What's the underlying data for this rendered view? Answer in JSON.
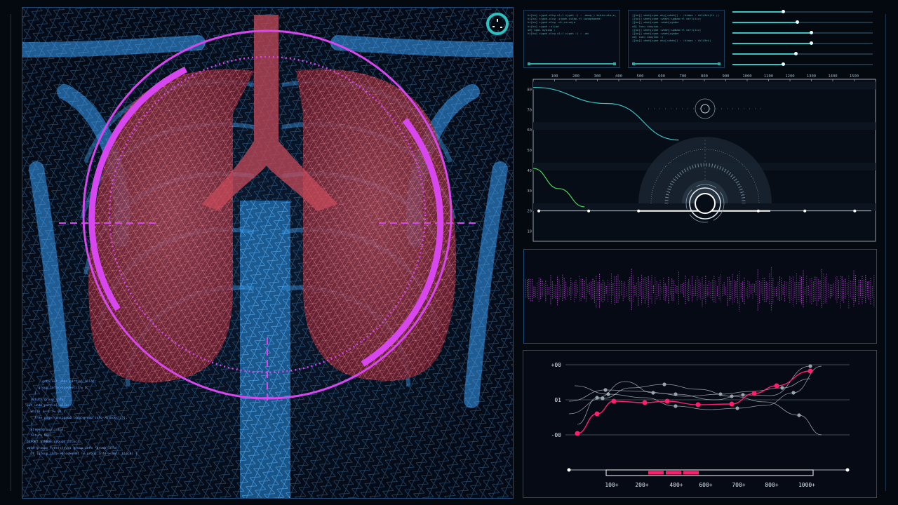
{
  "colors": {
    "magenta": "#d846ef",
    "bone_blue": "#3fa7ff",
    "lung_red": "#c63a48",
    "teal": "#39c4c4",
    "green": "#4cd65a",
    "pink": "#ff1f6d",
    "grey_line": "#9aa4ad"
  },
  "scan": {
    "dial_icon": "clock-dial-icon",
    "code_lines": [
      "        goto out_undo_partial_alloc;",
      "      group_info->blocks[i] = b;",
      "    }",
      "  return group_info;",
      "",
      "out_undo_partial_alloc:",
      "  while (--i >= 0) {",
      "    free_page((unsigned long)group_info->blocks[i]);",
      "  }",
      "  kfree(group_info);",
      "  return NULL;",
      "",
      "EXPORT_SYMBOL(groups_alloc);",
      "",
      "void groups_free(struct group_info *group_info)",
      "",
      "  if (group_info->blocks[0] != group_info->small_block) {"
    ]
  },
  "terminals": [
    {
      "lines": [
        "ki[ka] cjgoh-xlng ul;l cjgoh :( : -moxg ) kikiu:ata;e, ;",
        "",
        "ki[ka] cjgoh-xlng :cjgoh-cikko-rl ionopkpaea:",
        "ki[ka] cjgoh-xlng :ul;rurceja",
        "ki[ka] cjgoh :ul;bd",
        "u0] kgoi kyoiqo ;",
        "",
        "ki[ka] cjgoh-xlng ul;l cjgoh :( : -ab"
      ]
    },
    {
      "lines": [
        "[[ko]] wheh[uyoe uhy[:wheh[( : :kiapu : ikli5ei(li ;)",
        "",
        "[[ko]] wheh[uyoe :wheh[:ugbao:rl ocrl(iiu;",
        "[[ko]] wheh[uyoe :wheh[uyhbe:",
        "u0] lkeu ikoyiuk :",
        "",
        "[[ko]] wheh[uyoe :wheh[:ugbao:rl ocrl(iiu;",
        "[[ko]] wheh[uyoe :wheh[uyhbe:",
        "u0] lkeu ikoyiuk :)",
        "",
        "[[ko]] wheh[uyoe uhy[:wheh[( : :kiapu : ikli5ei("
      ]
    }
  ],
  "sliders": [
    0.36,
    0.46,
    0.56,
    0.56,
    0.45,
    0.36
  ],
  "gauge_chart": {
    "type": "line",
    "x_ticks": [
      "100",
      "200",
      "300",
      "400",
      "500",
      "600",
      "700",
      "800",
      "900",
      "1000",
      "1100",
      "1200",
      "1300",
      "1400",
      "1500"
    ],
    "y_ticks": [
      "80",
      "70",
      "60",
      "50",
      "40",
      "30",
      "20",
      "10"
    ],
    "xlim": [
      0,
      1600
    ],
    "ylim": [
      5,
      85
    ],
    "series": [
      {
        "color": "#39c4c4",
        "points": [
          [
            0,
            81
          ],
          [
            350,
            73
          ],
          [
            680,
            55
          ]
        ]
      },
      {
        "color": "#4cd65a",
        "points": [
          [
            0,
            41
          ],
          [
            120,
            31
          ],
          [
            240,
            22
          ]
        ]
      }
    ],
    "baseline_value": 20
  },
  "bottom_chart": {
    "type": "line",
    "y_ticks": [
      "+00",
      "01",
      "-00"
    ],
    "x_ticks": [
      "100+",
      "200+",
      "400+",
      "600+",
      "700+",
      "800+",
      "1000+"
    ],
    "highlight_series": [
      [
        0.03,
        0.02
      ],
      [
        0.1,
        0.3
      ],
      [
        0.16,
        0.48
      ],
      [
        0.27,
        0.46
      ],
      [
        0.35,
        0.48
      ],
      [
        0.46,
        0.43
      ],
      [
        0.58,
        0.44
      ],
      [
        0.66,
        0.59
      ],
      [
        0.74,
        0.7
      ],
      [
        0.86,
        0.91
      ]
    ],
    "grey_series": [
      [
        [
          0.0,
          0.48
        ],
        [
          0.13,
          0.64
        ],
        [
          0.25,
          0.62
        ],
        [
          0.38,
          0.58
        ],
        [
          0.52,
          0.5
        ],
        [
          0.62,
          0.57
        ],
        [
          0.72,
          0.56
        ],
        [
          0.86,
          0.98
        ]
      ],
      [
        [
          0.0,
          0.3
        ],
        [
          0.12,
          0.52
        ],
        [
          0.22,
          0.67
        ],
        [
          0.34,
          0.72
        ],
        [
          0.46,
          0.65
        ],
        [
          0.58,
          0.55
        ],
        [
          0.7,
          0.47
        ],
        [
          0.82,
          0.28
        ],
        [
          0.9,
          0.0
        ]
      ],
      [
        [
          0.02,
          0.7
        ],
        [
          0.14,
          0.58
        ],
        [
          0.27,
          0.53
        ],
        [
          0.38,
          0.41
        ],
        [
          0.5,
          0.36
        ],
        [
          0.6,
          0.38
        ],
        [
          0.7,
          0.42
        ],
        [
          0.8,
          0.6
        ],
        [
          0.9,
          0.98
        ]
      ],
      [
        [
          0.03,
          0.15
        ],
        [
          0.1,
          0.53
        ],
        [
          0.2,
          0.76
        ],
        [
          0.3,
          0.6
        ],
        [
          0.42,
          0.55
        ],
        [
          0.54,
          0.58
        ],
        [
          0.65,
          0.62
        ],
        [
          0.76,
          0.67
        ],
        [
          0.86,
          0.8
        ]
      ]
    ],
    "progress_segments": 3
  }
}
